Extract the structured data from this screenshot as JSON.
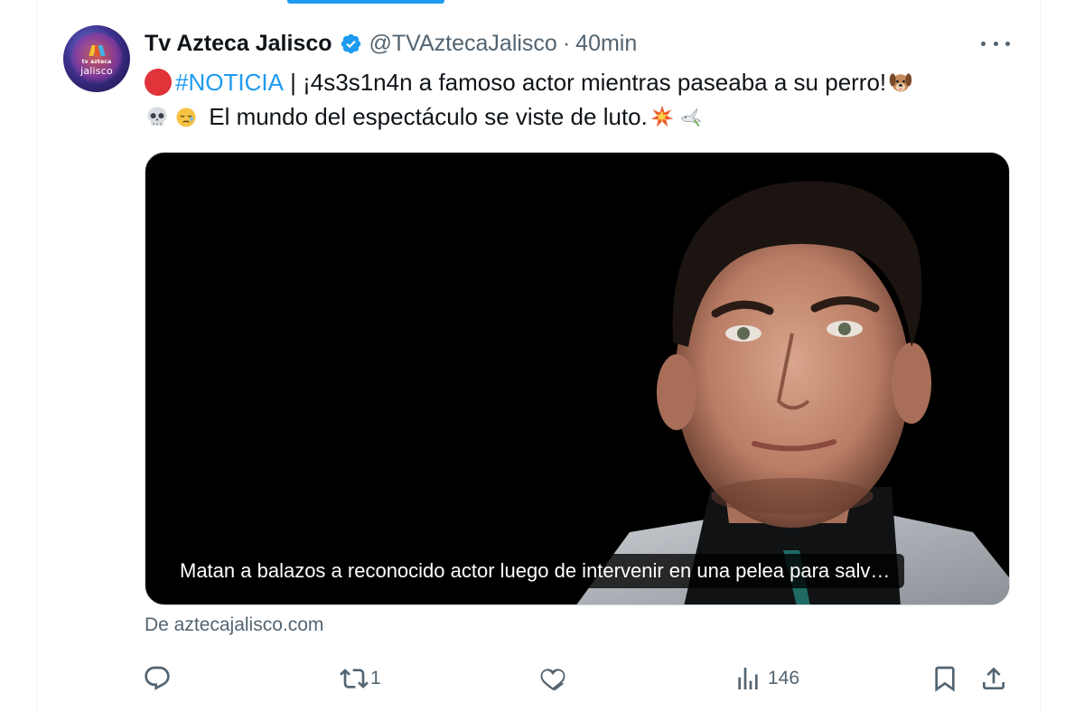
{
  "tweet": {
    "display_name": "Tv Azteca Jalisco",
    "handle": "@TVAztecaJalisco",
    "separator": "·",
    "time": "40min",
    "hashtag": "#NOTICIA",
    "line1_rest": " | ¡4s3s1n4n a famoso actor mientras paseaba a su perro!",
    "line2": " El mundo del espectáculo se viste de luto.",
    "emojis": [
      "red-circle",
      "dog-face",
      "skull",
      "sleeping-face",
      "collision",
      "dove"
    ]
  },
  "avatar": {
    "logo_top": "tv azteca",
    "logo_bottom": "jalisco"
  },
  "card": {
    "caption": "Matan a balazos a reconocido actor luego de intervenir en una pelea para salv…",
    "source": "De aztecajalisco.com"
  },
  "actions": {
    "reply_count": "",
    "retweet_count": "1",
    "like_count": "",
    "views_count": "146"
  },
  "colors": {
    "accent": "#1d9bf0",
    "text_secondary": "#536471",
    "verified": "#1d9bf0"
  }
}
